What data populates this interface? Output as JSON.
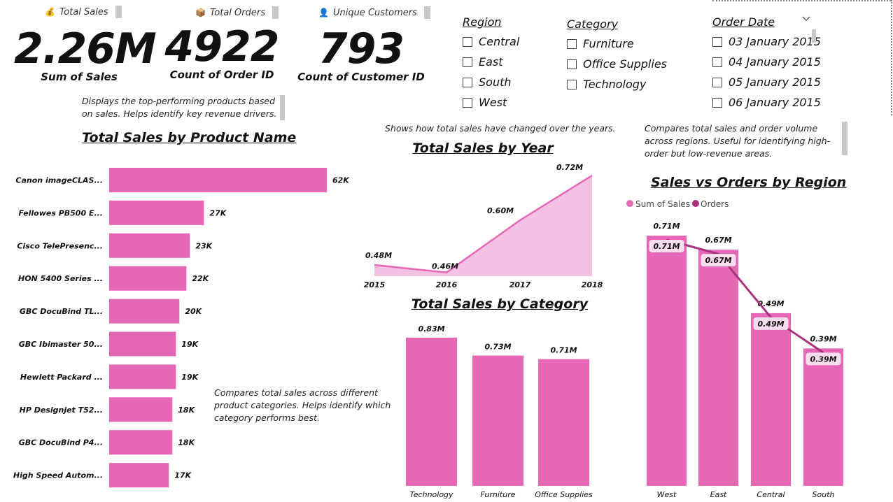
{
  "kpis": {
    "sales": {
      "header": "Total Sales",
      "icon": "💰",
      "value": "2.26M",
      "sub": "Sum of Sales"
    },
    "orders": {
      "header": "Total Orders",
      "icon": "📦",
      "value": "4922",
      "sub": "Count of Order ID"
    },
    "customers": {
      "header": "Unique Customers",
      "icon": "👤",
      "value": "793",
      "sub": "Count of Customer ID"
    }
  },
  "slicers": {
    "region": {
      "title": "Region",
      "items": [
        "Central",
        "East",
        "South",
        "West"
      ]
    },
    "category": {
      "title": "Category",
      "items": [
        "Furniture",
        "Office Supplies",
        "Technology"
      ]
    },
    "order_date": {
      "title": "Order Date",
      "items": [
        "03 January 2015",
        "04 January 2015",
        "05 January 2015",
        "06 January 2015"
      ]
    }
  },
  "descriptions": {
    "products": "Displays the top-performing products based on sales. Helps identify key revenue drivers.",
    "year": "Shows how total sales have changed over the years.",
    "region": "Compares total sales and order volume across regions. Useful for identifying high-order but low-revenue areas.",
    "category": "Compares total sales across different product categories. Helps identify which category performs best."
  },
  "colors": {
    "bar": "#e667b5",
    "area": "#f4c1e2",
    "line": "#e667b5",
    "orders_line": "#a8327c",
    "label_bg": "#f9dcee"
  },
  "chart_data": [
    {
      "type": "bar",
      "orientation": "horizontal",
      "title": "Total Sales by Product Name",
      "categories": [
        "Canon imageCLAS...",
        "Fellowes PB500 E...",
        "Cisco TelePresenc...",
        "HON 5400 Series ...",
        "GBC DocuBind TL...",
        "GBC Ibimaster 50...",
        "Hewlett Packard ...",
        "HP Designjet T52...",
        "GBC DocuBind P4...",
        "High Speed Autom..."
      ],
      "values": [
        62,
        27,
        23,
        22,
        20,
        19,
        19,
        18,
        18,
        17
      ],
      "labels": [
        "62K",
        "27K",
        "23K",
        "22K",
        "20K",
        "19K",
        "19K",
        "18K",
        "18K",
        "17K"
      ],
      "xlim": [
        0,
        62
      ]
    },
    {
      "type": "area",
      "title": "Total Sales by Year",
      "categories": [
        "2015",
        "2016",
        "2017",
        "2018"
      ],
      "values": [
        0.48,
        0.46,
        0.6,
        0.72
      ],
      "labels": [
        "0.48M",
        "0.46M",
        "0.60M",
        "0.72M"
      ],
      "ylim": [
        0.45,
        0.72
      ]
    },
    {
      "type": "bar",
      "title": "Total Sales by Category",
      "categories": [
        "Technology",
        "Furniture",
        "Office Supplies"
      ],
      "values": [
        0.83,
        0.73,
        0.71
      ],
      "labels": [
        "0.83M",
        "0.73M",
        "0.71M"
      ],
      "ylim": [
        0,
        0.83
      ]
    },
    {
      "type": "bar",
      "title": "Sales vs Orders by Region",
      "categories": [
        "West",
        "East",
        "Central",
        "South"
      ],
      "legend": [
        "Sum of Sales",
        "Orders"
      ],
      "legend_position": "top-left",
      "series": [
        {
          "name": "Sum of Sales",
          "kind": "bar",
          "values": [
            0.71,
            0.67,
            0.49,
            0.39
          ],
          "labels": [
            "0.71M",
            "0.67M",
            "0.49M",
            "0.39M"
          ]
        },
        {
          "name": "Orders",
          "kind": "line",
          "values": [
            0.71,
            0.67,
            0.49,
            0.39
          ],
          "labels": [
            "0.71M",
            "0.67M",
            "0.49M",
            "0.39M"
          ]
        }
      ],
      "ylim": [
        0,
        0.71
      ]
    }
  ]
}
